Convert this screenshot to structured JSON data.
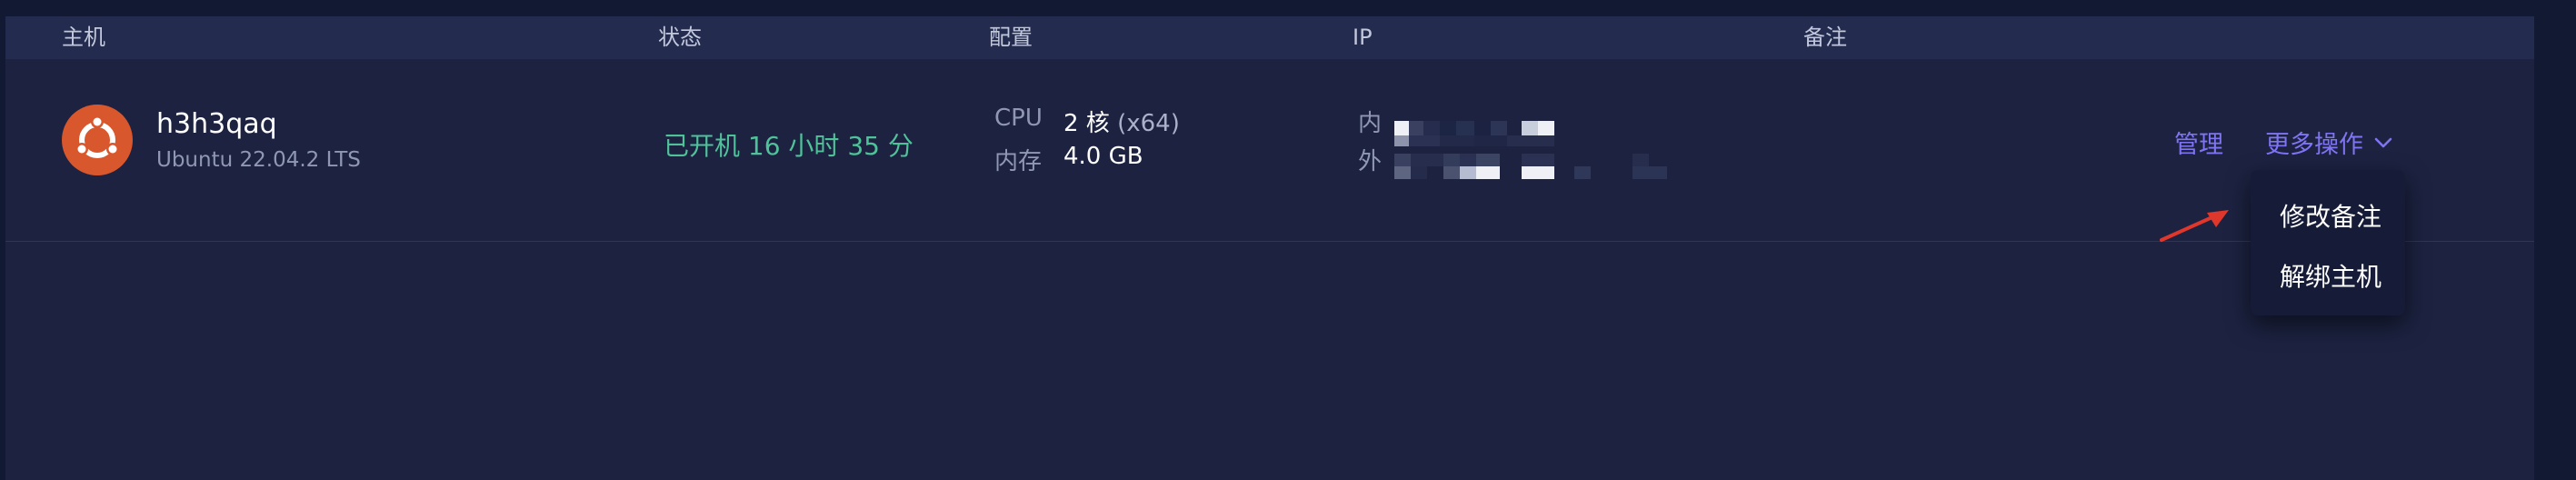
{
  "table": {
    "headers": {
      "host": "主机",
      "status": "状态",
      "config": "配置",
      "ip": "IP",
      "note": "备注"
    }
  },
  "host": {
    "name": "h3h3qaq",
    "os": "Ubuntu 22.04.2 LTS",
    "os_icon": "ubuntu-icon",
    "status": "已开机 16 小时 35 分",
    "status_color": "#4fc29a",
    "cpu_label": "CPU",
    "cpu_value": "2 核",
    "cpu_arch": "(x64)",
    "mem_label": "内存",
    "mem_value": "4.0 GB",
    "ip_inner_label": "内",
    "ip_outer_label": "外"
  },
  "actions": {
    "manage": "管理",
    "more": "更多操作",
    "more_icon": "chevron-down-icon"
  },
  "dropdown": {
    "items": [
      "修改备注",
      "解绑主机"
    ]
  },
  "colors": {
    "accent": "#7f74f2",
    "ubuntu": "#d9572c",
    "annotation_arrow": "#e0372c"
  }
}
